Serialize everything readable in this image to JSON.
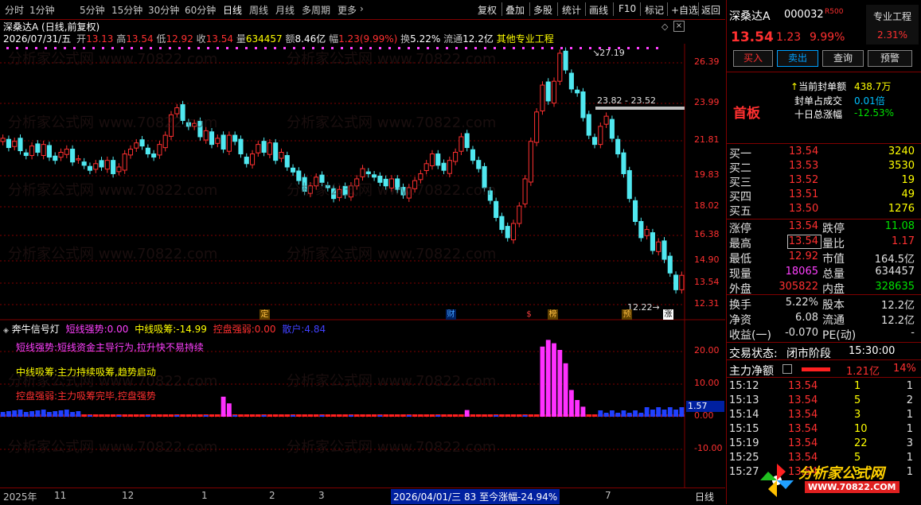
{
  "toolbar": {
    "periods": [
      "分时",
      "1分钟",
      "5分钟",
      "15分钟",
      "30分钟",
      "60分钟",
      "日线",
      "周线",
      "月线",
      "多周期",
      "更多"
    ],
    "active_period": "日线",
    "right_buttons": [
      "复权",
      "叠加",
      "多股",
      "统计",
      "画线",
      "F10",
      "标记",
      "+自选",
      "返回"
    ]
  },
  "header": {
    "title": "深桑达A (日线,前复权)",
    "info_date": "2026/07/31/五",
    "info_open_label": "开",
    "info_open": "13.13",
    "info_high_label": "高",
    "info_high": "13.54",
    "info_low_label": "低",
    "info_low": "12.92",
    "info_close_label": "收",
    "info_close": "13.54",
    "info_vol_label": "量",
    "info_vol": "634457",
    "info_amt_label": "额",
    "info_amt": "8.46亿",
    "info_amp_label": "幅",
    "info_amp": "1.23(9.99%)",
    "info_turn_label": "换",
    "info_turn": "5.22%",
    "info_float_label": "流通",
    "info_float": "12.2亿",
    "info_extra": "其他专业工程"
  },
  "price_axis": [
    "26.39",
    "23.99",
    "21.81",
    "19.83",
    "18.02",
    "16.38",
    "14.90",
    "13.54",
    "12.31"
  ],
  "annotations": {
    "high_mark": "27.19",
    "low_mark": "12.22",
    "gap_range": "23.82 - 23.52",
    "event_tags": [
      "定",
      "财",
      "$",
      "榜",
      "预",
      "涨"
    ]
  },
  "indicator": {
    "name": "奔牛信号灯",
    "short_label": "短线强势:",
    "short_value": "0.00",
    "mid_label": "中线吸筹:",
    "mid_value": "-14.99",
    "ctrl_label": "控盘强弱:",
    "ctrl_value": "0.00",
    "retail_label": "散户:",
    "retail_value": "4.84",
    "legend1": "短线强势:短线资金主导行为,拉升快不易持续",
    "legend2": "中线吸筹:主力持续吸筹,趋势启动",
    "legend3": "控盘强弱:主力吸筹完毕,控盘强势",
    "axis": [
      "20.00",
      "10.00",
      "0.00",
      "-10.00"
    ],
    "current_value": "1.57"
  },
  "timeline": {
    "labels": [
      "2025年",
      "11",
      "12",
      "1",
      "2",
      "3",
      "7"
    ],
    "status": "2026/04/01/三 83 至今涨幅-24.94%",
    "period_label": "日线"
  },
  "quote": {
    "name": "深桑达A",
    "code": "000032",
    "mark": "R500",
    "industry": "专业工程",
    "industry_pct": "2.31%",
    "price": "13.54",
    "change": "1.23",
    "change_pct": "9.99%",
    "actions": [
      "买入",
      "卖出",
      "查询",
      "预警"
    ],
    "limit_tag": "首板",
    "seal_amount_label": "当前封单额",
    "seal_amount": "438.7万",
    "seal_ratio_label": "封单占成交",
    "seal_ratio": "0.01倍",
    "ten_day_label": "十日总涨幅",
    "ten_day": "-12.53%"
  },
  "order_book": [
    {
      "label": "买一",
      "price": "13.54",
      "vol": "3240"
    },
    {
      "label": "买二",
      "price": "13.53",
      "vol": "3530"
    },
    {
      "label": "买三",
      "price": "13.52",
      "vol": "19"
    },
    {
      "label": "买四",
      "price": "13.51",
      "vol": "49"
    },
    {
      "label": "买五",
      "price": "13.50",
      "vol": "1276"
    }
  ],
  "stats": [
    {
      "l1": "涨停",
      "v1": "13.54",
      "l2": "跌停",
      "v2": "11.08"
    },
    {
      "l1": "最高",
      "v1": "13.54",
      "l2": "量比",
      "v2": "1.17"
    },
    {
      "l1": "最低",
      "v1": "12.92",
      "l2": "市值",
      "v2": "164.5亿"
    },
    {
      "l1": "现量",
      "v1": "18065",
      "l2": "总量",
      "v2": "634457"
    },
    {
      "l1": "外盘",
      "v1": "305822",
      "l2": "内盘",
      "v2": "328635"
    }
  ],
  "stats2": [
    {
      "l1": "换手",
      "v1": "5.22%",
      "l2": "股本",
      "v2": "12.2亿"
    },
    {
      "l1": "净资",
      "v1": "6.08",
      "l2": "流通",
      "v2": "12.2亿"
    },
    {
      "l1": "收益(一)",
      "v1": "-0.070",
      "l2": "PE(动)",
      "v2": "-"
    }
  ],
  "trade_status_label": "交易状态:",
  "trade_status": "闭市阶段",
  "trade_time": "15:30:00",
  "main_flow_label": "主力净额",
  "main_flow": "1.21亿",
  "main_flow_pct": "14%",
  "ticks": [
    {
      "t": "15:12",
      "p": "13.54",
      "v": "1",
      "n": "1"
    },
    {
      "t": "15:13",
      "p": "13.54",
      "v": "5",
      "n": "2"
    },
    {
      "t": "15:14",
      "p": "13.54",
      "v": "3",
      "n": "1"
    },
    {
      "t": "15:15",
      "p": "13.54",
      "v": "10",
      "n": "1"
    },
    {
      "t": "15:19",
      "p": "13.54",
      "v": "22",
      "n": "3"
    },
    {
      "t": "15:25",
      "p": "13.54",
      "v": "5",
      "n": "1"
    },
    {
      "t": "15:27",
      "p": "13.54",
      "v": "3",
      "n": "1"
    }
  ],
  "watermark_text": "分析家公式网 www.70822.com",
  "logo_text": "分析家公式网",
  "logo_url": "WWW.70822.COM",
  "colors": {
    "up": "#ff3030",
    "down": "#50e8f0",
    "bg": "#000000",
    "grid": "#800000"
  }
}
